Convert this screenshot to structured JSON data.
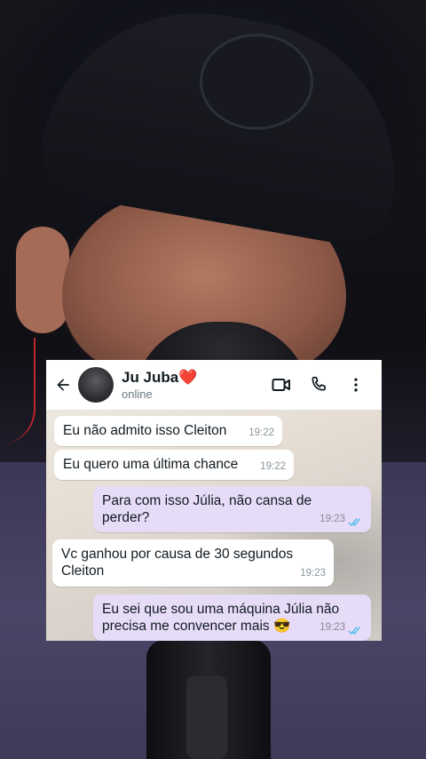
{
  "contact": {
    "name": "Ju Juba",
    "heart": "❤️",
    "status": "online"
  },
  "icons": {
    "back": "arrow-left-icon",
    "video": "video-camera-icon",
    "call": "phone-icon",
    "menu": "more-vertical-icon",
    "read": "double-check-icon"
  },
  "colors": {
    "header_bg": "#ffffff",
    "incoming_bubble": "#ffffff",
    "outgoing_bubble": "#e7dcf7",
    "read_ticks": "#53bdeb"
  },
  "messages": [
    {
      "direction": "in",
      "text": "Eu não admito isso Cleiton",
      "time": "19:22"
    },
    {
      "direction": "in",
      "text": "Eu quero uma última chance",
      "time": "19:22"
    },
    {
      "direction": "out",
      "text": "Para com isso Júlia, não cansa de perder?",
      "time": "19:23",
      "read": true
    },
    {
      "direction": "in",
      "text": "Vc ganhou por causa de 30 segundos Cleiton",
      "time": "19:23"
    },
    {
      "direction": "out",
      "text": "Eu sei que sou uma máquina Júlia não precisa me convencer mais 😎",
      "time": "19:23",
      "read": true
    }
  ]
}
